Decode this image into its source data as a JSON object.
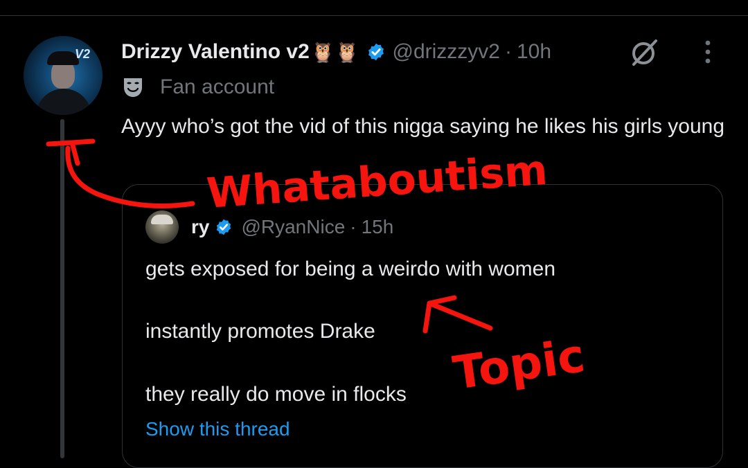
{
  "tweet": {
    "author": {
      "display_name": "Drizzy Valentino v2",
      "emoji": "🦉🦉",
      "handle": "@drizzzyv2",
      "time": "10h",
      "separator": "·"
    },
    "label": "Fan account",
    "text": "Ayyy who’s got the vid of this nigga saying he likes his girls young",
    "quoted": {
      "author_name": "ry",
      "handle": "@RyanNice",
      "time": "15h",
      "separator": "·",
      "lines": [
        "gets exposed for being a weirdo with women",
        "instantly promotes Drake",
        "they really do move in flocks"
      ],
      "show_thread": "Show this thread"
    }
  },
  "annotations": {
    "whataboutism": "Whataboutism",
    "topic": "Topic"
  },
  "icons": {
    "verified": "verified-badge-icon",
    "grok": "grok-icon",
    "more": "more-vertical-icon",
    "label": "theater-mask-icon"
  },
  "colors": {
    "background": "#000000",
    "text": "#e7e9ea",
    "muted": "#71767b",
    "link": "#1d9bf0",
    "annotation": "#f5140e"
  }
}
